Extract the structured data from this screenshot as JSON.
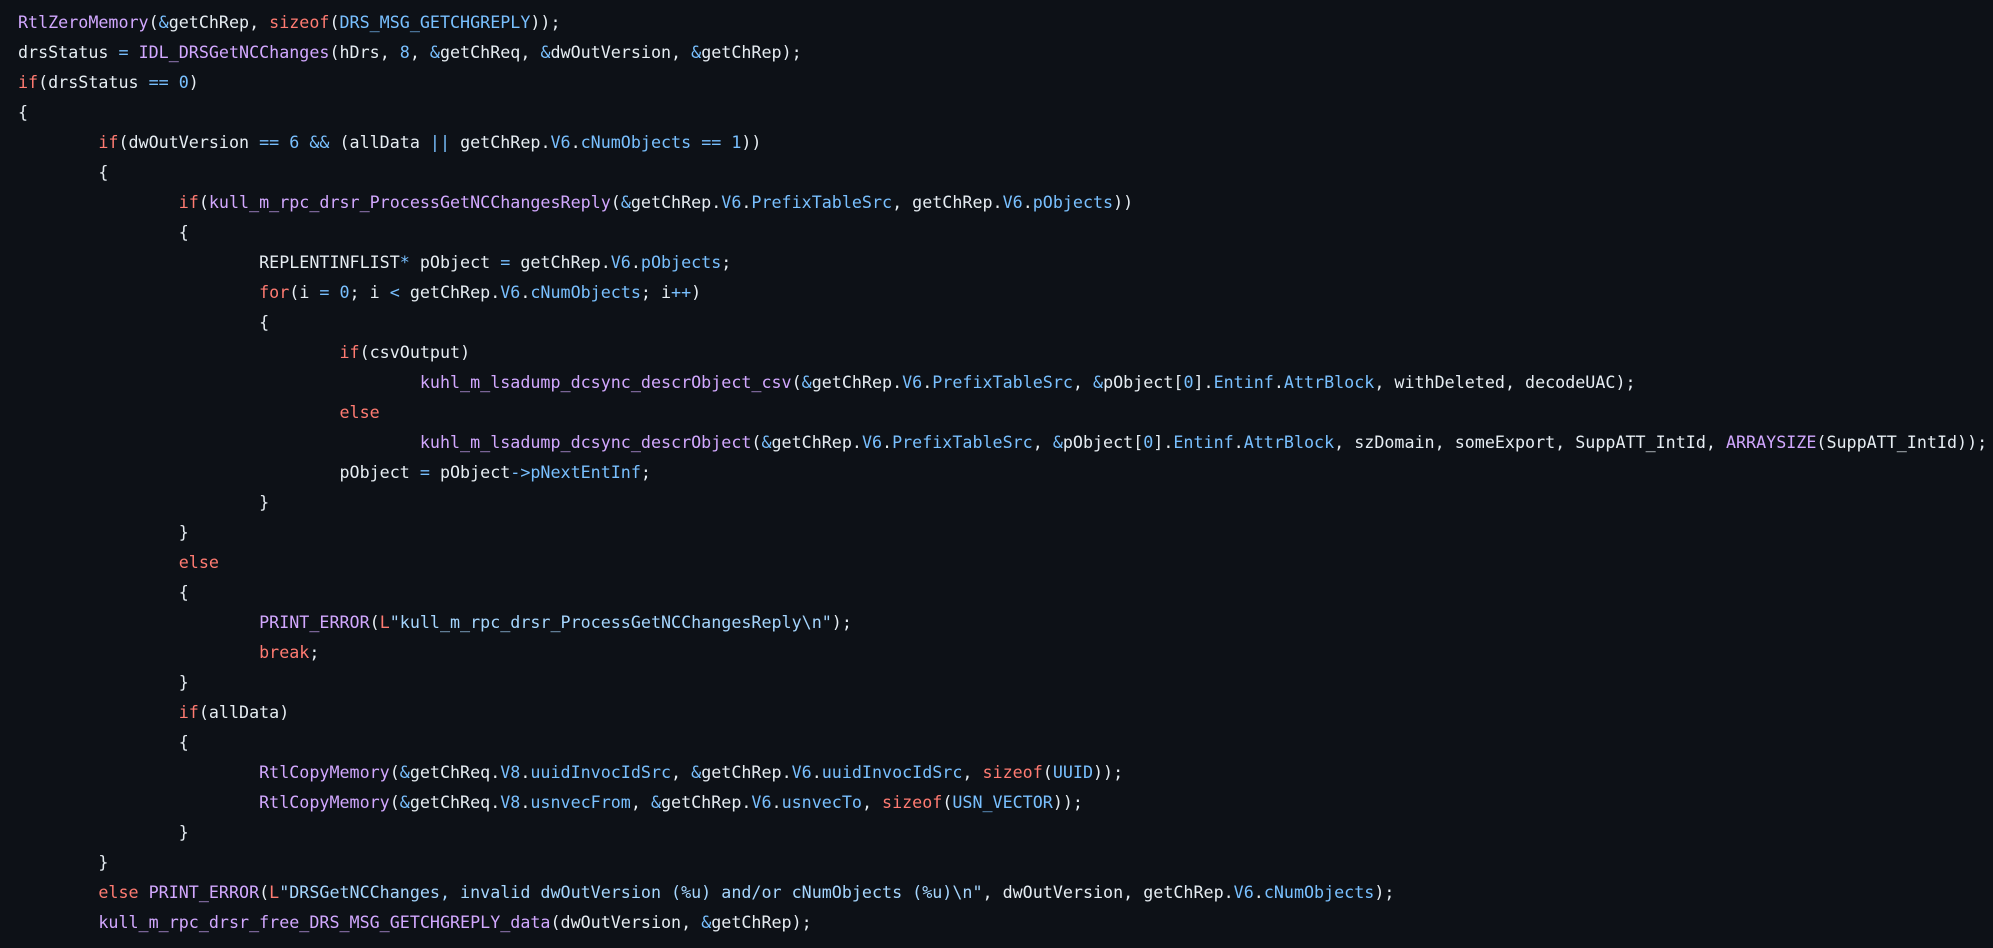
{
  "colors": {
    "background": "#0d1117",
    "text": "#e6edf3",
    "function": "#d2a8ff",
    "keyword": "#ff7b72",
    "property": "#79c0ff",
    "operator": "#79c0ff",
    "number": "#79c0ff",
    "string": "#a5d6ff"
  },
  "code": {
    "lines": [
      [
        [
          "func",
          "RtlZeroMemory"
        ],
        [
          "punc",
          "("
        ],
        [
          "op",
          "&"
        ],
        [
          "id",
          "getChRep"
        ],
        [
          "punc",
          ", "
        ],
        [
          "kw",
          "sizeof"
        ],
        [
          "punc",
          "("
        ],
        [
          "prop",
          "DRS_MSG_GETCHGREPLY"
        ],
        [
          "punc",
          "));"
        ]
      ],
      [
        [
          "id",
          "drsStatus"
        ],
        [
          "punc",
          " "
        ],
        [
          "op",
          "="
        ],
        [
          "punc",
          " "
        ],
        [
          "func",
          "IDL_DRSGetNCChanges"
        ],
        [
          "punc",
          "("
        ],
        [
          "id",
          "hDrs"
        ],
        [
          "punc",
          ", "
        ],
        [
          "num",
          "8"
        ],
        [
          "punc",
          ", "
        ],
        [
          "op",
          "&"
        ],
        [
          "id",
          "getChReq"
        ],
        [
          "punc",
          ", "
        ],
        [
          "op",
          "&"
        ],
        [
          "id",
          "dwOutVersion"
        ],
        [
          "punc",
          ", "
        ],
        [
          "op",
          "&"
        ],
        [
          "id",
          "getChRep"
        ],
        [
          "punc",
          ");"
        ]
      ],
      [
        [
          "kw",
          "if"
        ],
        [
          "punc",
          "("
        ],
        [
          "id",
          "drsStatus"
        ],
        [
          "punc",
          " "
        ],
        [
          "op",
          "=="
        ],
        [
          "punc",
          " "
        ],
        [
          "num",
          "0"
        ],
        [
          "punc",
          ")"
        ]
      ],
      [
        [
          "punc",
          "{"
        ]
      ],
      [
        [
          "ws",
          "\t"
        ],
        [
          "kw",
          "if"
        ],
        [
          "punc",
          "("
        ],
        [
          "id",
          "dwOutVersion"
        ],
        [
          "punc",
          " "
        ],
        [
          "op",
          "=="
        ],
        [
          "punc",
          " "
        ],
        [
          "num",
          "6"
        ],
        [
          "punc",
          " "
        ],
        [
          "op",
          "&&"
        ],
        [
          "punc",
          " ("
        ],
        [
          "id",
          "allData"
        ],
        [
          "punc",
          " "
        ],
        [
          "op",
          "||"
        ],
        [
          "punc",
          " "
        ],
        [
          "id",
          "getChRep"
        ],
        [
          "punc",
          "."
        ],
        [
          "prop",
          "V6"
        ],
        [
          "punc",
          "."
        ],
        [
          "prop",
          "cNumObjects"
        ],
        [
          "punc",
          " "
        ],
        [
          "op",
          "=="
        ],
        [
          "punc",
          " "
        ],
        [
          "num",
          "1"
        ],
        [
          "punc",
          "))"
        ]
      ],
      [
        [
          "ws",
          "\t"
        ],
        [
          "punc",
          "{"
        ]
      ],
      [
        [
          "ws",
          "\t\t"
        ],
        [
          "kw",
          "if"
        ],
        [
          "punc",
          "("
        ],
        [
          "func",
          "kull_m_rpc_drsr_ProcessGetNCChangesReply"
        ],
        [
          "punc",
          "("
        ],
        [
          "op",
          "&"
        ],
        [
          "id",
          "getChRep"
        ],
        [
          "punc",
          "."
        ],
        [
          "prop",
          "V6"
        ],
        [
          "punc",
          "."
        ],
        [
          "prop",
          "PrefixTableSrc"
        ],
        [
          "punc",
          ", "
        ],
        [
          "id",
          "getChRep"
        ],
        [
          "punc",
          "."
        ],
        [
          "prop",
          "V6"
        ],
        [
          "punc",
          "."
        ],
        [
          "prop",
          "pObjects"
        ],
        [
          "punc",
          "))"
        ]
      ],
      [
        [
          "ws",
          "\t\t"
        ],
        [
          "punc",
          "{"
        ]
      ],
      [
        [
          "ws",
          "\t\t\t"
        ],
        [
          "id",
          "REPLENTINFLIST"
        ],
        [
          "op",
          "*"
        ],
        [
          "punc",
          " "
        ],
        [
          "id",
          "pObject"
        ],
        [
          "punc",
          " "
        ],
        [
          "op",
          "="
        ],
        [
          "punc",
          " "
        ],
        [
          "id",
          "getChRep"
        ],
        [
          "punc",
          "."
        ],
        [
          "prop",
          "V6"
        ],
        [
          "punc",
          "."
        ],
        [
          "prop",
          "pObjects"
        ],
        [
          "punc",
          ";"
        ]
      ],
      [
        [
          "ws",
          "\t\t\t"
        ],
        [
          "kw",
          "for"
        ],
        [
          "punc",
          "("
        ],
        [
          "id",
          "i"
        ],
        [
          "punc",
          " "
        ],
        [
          "op",
          "="
        ],
        [
          "punc",
          " "
        ],
        [
          "num",
          "0"
        ],
        [
          "punc",
          "; "
        ],
        [
          "id",
          "i"
        ],
        [
          "punc",
          " "
        ],
        [
          "op",
          "<"
        ],
        [
          "punc",
          " "
        ],
        [
          "id",
          "getChRep"
        ],
        [
          "punc",
          "."
        ],
        [
          "prop",
          "V6"
        ],
        [
          "punc",
          "."
        ],
        [
          "prop",
          "cNumObjects"
        ],
        [
          "punc",
          "; "
        ],
        [
          "id",
          "i"
        ],
        [
          "op",
          "++"
        ],
        [
          "punc",
          ")"
        ]
      ],
      [
        [
          "ws",
          "\t\t\t"
        ],
        [
          "punc",
          "{"
        ]
      ],
      [
        [
          "ws",
          "\t\t\t\t"
        ],
        [
          "kw",
          "if"
        ],
        [
          "punc",
          "("
        ],
        [
          "id",
          "csvOutput"
        ],
        [
          "punc",
          ")"
        ]
      ],
      [
        [
          "ws",
          "\t\t\t\t\t"
        ],
        [
          "func",
          "kuhl_m_lsadump_dcsync_descrObject_csv"
        ],
        [
          "punc",
          "("
        ],
        [
          "op",
          "&"
        ],
        [
          "id",
          "getChRep"
        ],
        [
          "punc",
          "."
        ],
        [
          "prop",
          "V6"
        ],
        [
          "punc",
          "."
        ],
        [
          "prop",
          "PrefixTableSrc"
        ],
        [
          "punc",
          ", "
        ],
        [
          "op",
          "&"
        ],
        [
          "id",
          "pObject"
        ],
        [
          "punc",
          "["
        ],
        [
          "num",
          "0"
        ],
        [
          "punc",
          "]."
        ],
        [
          "prop",
          "Entinf"
        ],
        [
          "punc",
          "."
        ],
        [
          "prop",
          "AttrBlock"
        ],
        [
          "punc",
          ", "
        ],
        [
          "id",
          "withDeleted"
        ],
        [
          "punc",
          ", "
        ],
        [
          "id",
          "decodeUAC"
        ],
        [
          "punc",
          ");"
        ]
      ],
      [
        [
          "ws",
          "\t\t\t\t"
        ],
        [
          "kw",
          "else"
        ]
      ],
      [
        [
          "ws",
          "\t\t\t\t\t"
        ],
        [
          "func",
          "kuhl_m_lsadump_dcsync_descrObject"
        ],
        [
          "punc",
          "("
        ],
        [
          "op",
          "&"
        ],
        [
          "id",
          "getChRep"
        ],
        [
          "punc",
          "."
        ],
        [
          "prop",
          "V6"
        ],
        [
          "punc",
          "."
        ],
        [
          "prop",
          "PrefixTableSrc"
        ],
        [
          "punc",
          ", "
        ],
        [
          "op",
          "&"
        ],
        [
          "id",
          "pObject"
        ],
        [
          "punc",
          "["
        ],
        [
          "num",
          "0"
        ],
        [
          "punc",
          "]."
        ],
        [
          "prop",
          "Entinf"
        ],
        [
          "punc",
          "."
        ],
        [
          "prop",
          "AttrBlock"
        ],
        [
          "punc",
          ", "
        ],
        [
          "id",
          "szDomain"
        ],
        [
          "punc",
          ", "
        ],
        [
          "id",
          "someExport"
        ],
        [
          "punc",
          ", "
        ],
        [
          "id",
          "SuppATT_IntId"
        ],
        [
          "punc",
          ", "
        ],
        [
          "func",
          "ARRAYSIZE"
        ],
        [
          "punc",
          "("
        ],
        [
          "id",
          "SuppATT_IntId"
        ],
        [
          "punc",
          "));"
        ]
      ],
      [
        [
          "ws",
          "\t\t\t\t"
        ],
        [
          "id",
          "pObject"
        ],
        [
          "punc",
          " "
        ],
        [
          "op",
          "="
        ],
        [
          "punc",
          " "
        ],
        [
          "id",
          "pObject"
        ],
        [
          "op",
          "->"
        ],
        [
          "prop",
          "pNextEntInf"
        ],
        [
          "punc",
          ";"
        ]
      ],
      [
        [
          "ws",
          "\t\t\t"
        ],
        [
          "punc",
          "}"
        ]
      ],
      [
        [
          "ws",
          "\t\t"
        ],
        [
          "punc",
          "}"
        ]
      ],
      [
        [
          "ws",
          "\t\t"
        ],
        [
          "kw",
          "else"
        ]
      ],
      [
        [
          "ws",
          "\t\t"
        ],
        [
          "punc",
          "{"
        ]
      ],
      [
        [
          "ws",
          "\t\t\t"
        ],
        [
          "func",
          "PRINT_ERROR"
        ],
        [
          "punc",
          "("
        ],
        [
          "kw",
          "L"
        ],
        [
          "str",
          "\"kull_m_rpc_drsr_ProcessGetNCChangesReply\\n\""
        ],
        [
          "punc",
          ");"
        ]
      ],
      [
        [
          "ws",
          "\t\t\t"
        ],
        [
          "kw",
          "break"
        ],
        [
          "punc",
          ";"
        ]
      ],
      [
        [
          "ws",
          "\t\t"
        ],
        [
          "punc",
          "}"
        ]
      ],
      [
        [
          "ws",
          "\t\t"
        ],
        [
          "kw",
          "if"
        ],
        [
          "punc",
          "("
        ],
        [
          "id",
          "allData"
        ],
        [
          "punc",
          ")"
        ]
      ],
      [
        [
          "ws",
          "\t\t"
        ],
        [
          "punc",
          "{"
        ]
      ],
      [
        [
          "ws",
          "\t\t\t"
        ],
        [
          "func",
          "RtlCopyMemory"
        ],
        [
          "punc",
          "("
        ],
        [
          "op",
          "&"
        ],
        [
          "id",
          "getChReq"
        ],
        [
          "punc",
          "."
        ],
        [
          "prop",
          "V8"
        ],
        [
          "punc",
          "."
        ],
        [
          "prop",
          "uuidInvocIdSrc"
        ],
        [
          "punc",
          ", "
        ],
        [
          "op",
          "&"
        ],
        [
          "id",
          "getChRep"
        ],
        [
          "punc",
          "."
        ],
        [
          "prop",
          "V6"
        ],
        [
          "punc",
          "."
        ],
        [
          "prop",
          "uuidInvocIdSrc"
        ],
        [
          "punc",
          ", "
        ],
        [
          "kw",
          "sizeof"
        ],
        [
          "punc",
          "("
        ],
        [
          "prop",
          "UUID"
        ],
        [
          "punc",
          "));"
        ]
      ],
      [
        [
          "ws",
          "\t\t\t"
        ],
        [
          "func",
          "RtlCopyMemory"
        ],
        [
          "punc",
          "("
        ],
        [
          "op",
          "&"
        ],
        [
          "id",
          "getChReq"
        ],
        [
          "punc",
          "."
        ],
        [
          "prop",
          "V8"
        ],
        [
          "punc",
          "."
        ],
        [
          "prop",
          "usnvecFrom"
        ],
        [
          "punc",
          ", "
        ],
        [
          "op",
          "&"
        ],
        [
          "id",
          "getChRep"
        ],
        [
          "punc",
          "."
        ],
        [
          "prop",
          "V6"
        ],
        [
          "punc",
          "."
        ],
        [
          "prop",
          "usnvecTo"
        ],
        [
          "punc",
          ", "
        ],
        [
          "kw",
          "sizeof"
        ],
        [
          "punc",
          "("
        ],
        [
          "prop",
          "USN_VECTOR"
        ],
        [
          "punc",
          "));"
        ]
      ],
      [
        [
          "ws",
          "\t\t"
        ],
        [
          "punc",
          "}"
        ]
      ],
      [
        [
          "ws",
          "\t"
        ],
        [
          "punc",
          "}"
        ]
      ],
      [
        [
          "ws",
          "\t"
        ],
        [
          "kw",
          "else"
        ],
        [
          "punc",
          " "
        ],
        [
          "func",
          "PRINT_ERROR"
        ],
        [
          "punc",
          "("
        ],
        [
          "kw",
          "L"
        ],
        [
          "str",
          "\"DRSGetNCChanges, invalid dwOutVersion (%u) and/or cNumObjects (%u)\\n\""
        ],
        [
          "punc",
          ", "
        ],
        [
          "id",
          "dwOutVersion"
        ],
        [
          "punc",
          ", "
        ],
        [
          "id",
          "getChRep"
        ],
        [
          "punc",
          "."
        ],
        [
          "prop",
          "V6"
        ],
        [
          "punc",
          "."
        ],
        [
          "prop",
          "cNumObjects"
        ],
        [
          "punc",
          ");"
        ]
      ],
      [
        [
          "ws",
          "\t"
        ],
        [
          "func",
          "kull_m_rpc_drsr_free_DRS_MSG_GETCHGREPLY_data"
        ],
        [
          "punc",
          "("
        ],
        [
          "id",
          "dwOutVersion"
        ],
        [
          "punc",
          ", "
        ],
        [
          "op",
          "&"
        ],
        [
          "id",
          "getChRep"
        ],
        [
          "punc",
          ");"
        ]
      ]
    ]
  }
}
